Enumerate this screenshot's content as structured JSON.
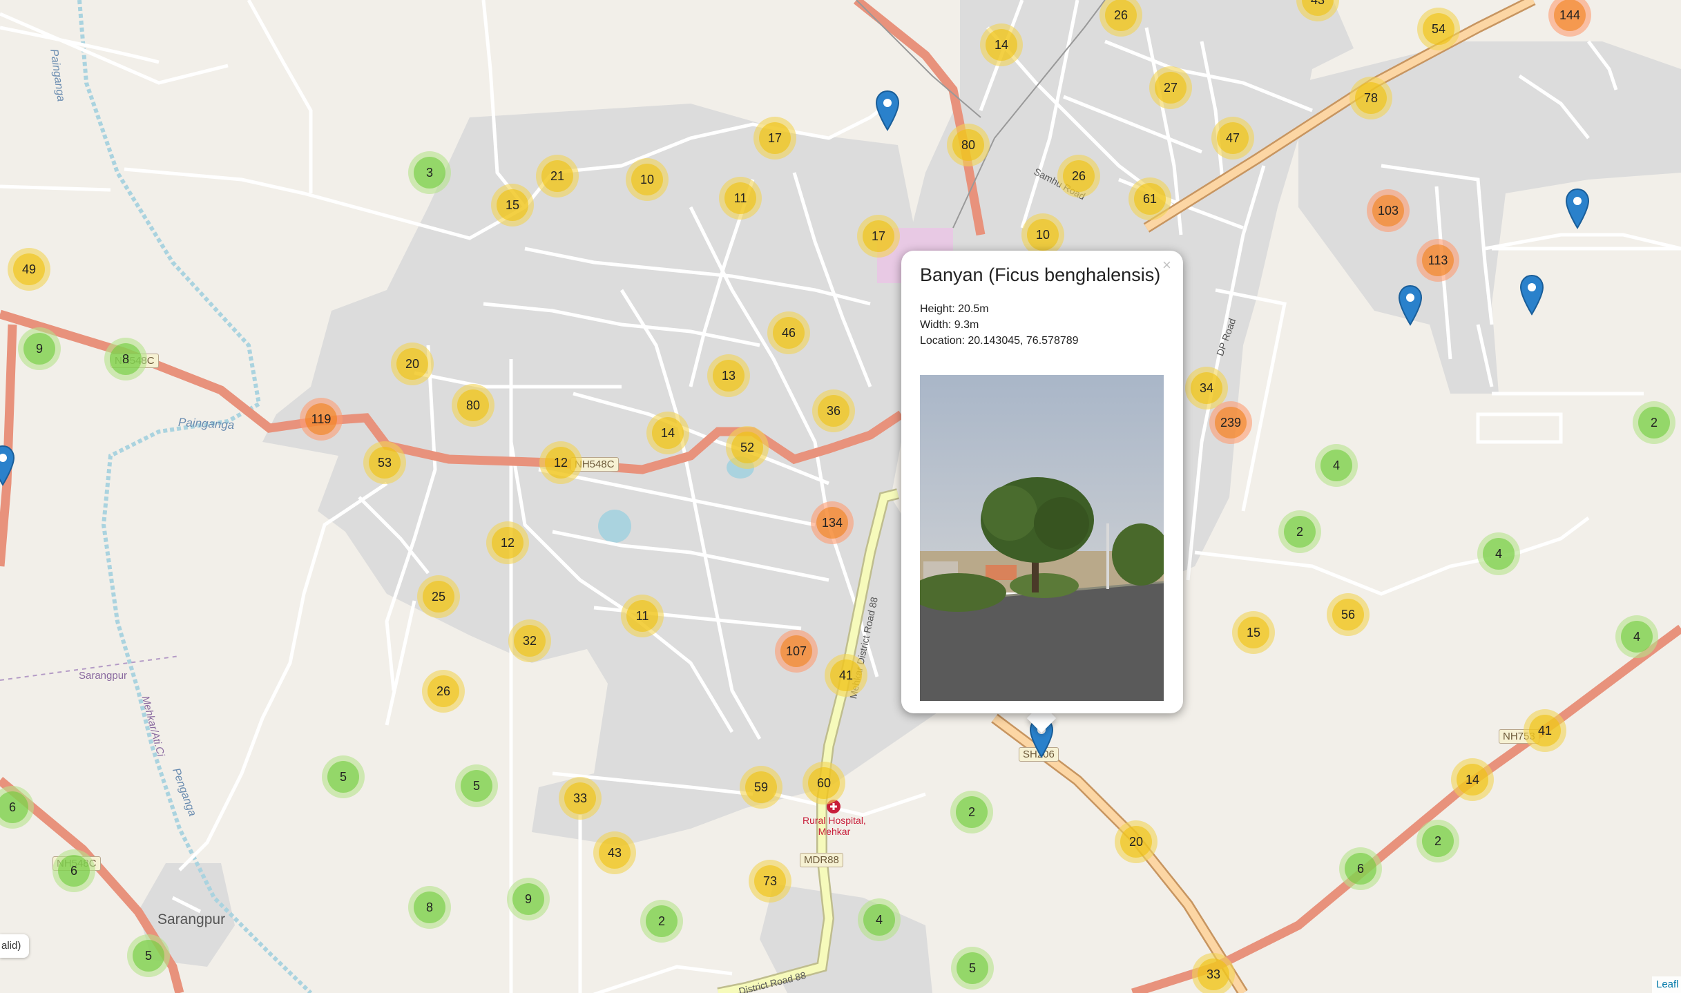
{
  "map": {
    "labels": {
      "river_north": "Painganga",
      "river_west": "Painganga",
      "river_south": "Penganga",
      "stream": "Mehkar/Ati.Ci",
      "road_samhu": "Samhu Road",
      "road_dp": "DP Road",
      "road_mdr": "Mehkar District Road 88",
      "road_district_south": "District Road 88",
      "village_area": "Sarangpur",
      "village_small": "Sarangpur",
      "hospital": "Rural Hospital,\nMehkar"
    },
    "shields": {
      "nh548c_a": "NH548C",
      "nh548c_b": "NH548C",
      "nh548c_c": "NH548C",
      "sh206": "SH206",
      "mdr88": "MDR88",
      "nh753": "NH753"
    }
  },
  "clusters": [
    {
      "count": 26,
      "size": "medium"
    },
    {
      "count": 43,
      "size": "medium"
    },
    {
      "count": 54,
      "size": "medium"
    },
    {
      "count": 144,
      "size": "large"
    },
    {
      "count": 14,
      "size": "medium"
    },
    {
      "count": 27,
      "size": "medium"
    },
    {
      "count": 78,
      "size": "medium"
    },
    {
      "count": 47,
      "size": "medium"
    },
    {
      "count": 17,
      "size": "medium"
    },
    {
      "count": 80,
      "size": "medium"
    },
    {
      "count": 26,
      "size": "medium"
    },
    {
      "count": 3,
      "size": "small"
    },
    {
      "count": 21,
      "size": "medium"
    },
    {
      "count": 10,
      "size": "medium"
    },
    {
      "count": 61,
      "size": "medium"
    },
    {
      "count": 103,
      "size": "large"
    },
    {
      "count": 15,
      "size": "medium"
    },
    {
      "count": 11,
      "size": "medium"
    },
    {
      "count": 17,
      "size": "medium"
    },
    {
      "count": 10,
      "size": "medium"
    },
    {
      "count": 113,
      "size": "large"
    },
    {
      "count": 49,
      "size": "medium"
    },
    {
      "count": 9,
      "size": "small"
    },
    {
      "count": 8,
      "size": "small"
    },
    {
      "count": 46,
      "size": "medium"
    },
    {
      "count": 20,
      "size": "medium"
    },
    {
      "count": 13,
      "size": "medium"
    },
    {
      "count": 34,
      "size": "medium"
    },
    {
      "count": 80,
      "size": "medium"
    },
    {
      "count": 36,
      "size": "medium"
    },
    {
      "count": 119,
      "size": "large"
    },
    {
      "count": 239,
      "size": "large"
    },
    {
      "count": 2,
      "size": "small"
    },
    {
      "count": 14,
      "size": "medium"
    },
    {
      "count": 52,
      "size": "medium"
    },
    {
      "count": 53,
      "size": "medium"
    },
    {
      "count": 12,
      "size": "medium"
    },
    {
      "count": 4,
      "size": "small"
    },
    {
      "count": 134,
      "size": "large"
    },
    {
      "count": 2,
      "size": "small"
    },
    {
      "count": 12,
      "size": "medium"
    },
    {
      "count": 4,
      "size": "small"
    },
    {
      "count": 25,
      "size": "medium"
    },
    {
      "count": 56,
      "size": "medium"
    },
    {
      "count": 11,
      "size": "medium"
    },
    {
      "count": 15,
      "size": "medium"
    },
    {
      "count": 4,
      "size": "small"
    },
    {
      "count": 32,
      "size": "medium"
    },
    {
      "count": 107,
      "size": "large"
    },
    {
      "count": 41,
      "size": "medium"
    },
    {
      "count": 26,
      "size": "medium"
    },
    {
      "count": 41,
      "size": "medium"
    },
    {
      "count": 5,
      "size": "small"
    },
    {
      "count": 5,
      "size": "small"
    },
    {
      "count": 14,
      "size": "medium"
    },
    {
      "count": 59,
      "size": "medium"
    },
    {
      "count": 60,
      "size": "medium"
    },
    {
      "count": 33,
      "size": "medium"
    },
    {
      "count": 6,
      "size": "small"
    },
    {
      "count": 2,
      "size": "small"
    },
    {
      "count": 20,
      "size": "medium"
    },
    {
      "count": 2,
      "size": "small"
    },
    {
      "count": 43,
      "size": "medium"
    },
    {
      "count": 6,
      "size": "small"
    },
    {
      "count": 6,
      "size": "small"
    },
    {
      "count": 73,
      "size": "medium"
    },
    {
      "count": 8,
      "size": "small"
    },
    {
      "count": 9,
      "size": "small"
    },
    {
      "count": 2,
      "size": "small"
    },
    {
      "count": 4,
      "size": "small"
    },
    {
      "count": 5,
      "size": "small"
    },
    {
      "count": 5,
      "size": "small"
    },
    {
      "count": 33,
      "size": "medium"
    }
  ],
  "popup": {
    "title": "Banyan (Ficus benghalensis)",
    "height": "Height: 20.5m",
    "width": "Width: 9.3m",
    "location": "Location: 20.143045, 76.578789",
    "close_glyph": "×"
  },
  "attribution": {
    "left": "alid)",
    "right": "Leafl"
  },
  "colors": {
    "background": "#f2efe9",
    "urban": "#dcdcdc",
    "highway": "#e8927c",
    "trunk": "#fcd6a4",
    "secondary": "#f6fabb",
    "water": "#aad3df",
    "marker": "#2a81cb"
  }
}
